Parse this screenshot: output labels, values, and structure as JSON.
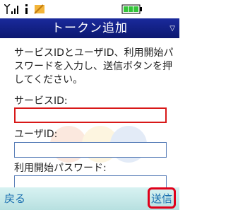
{
  "status": {
    "signal_icon": "signal-strength-icon",
    "mode_icon": "i-mode-icon",
    "mail_icon": "mail-icon",
    "battery_icon": "battery-icon",
    "battery_color": "#34c43a"
  },
  "header": {
    "title": "トークン追加",
    "menu_icon": "chevron-down-icon",
    "background": "#14218a"
  },
  "form": {
    "intro": "サービスIDとユーザID、利用開始パスワードを入力し、送信ボタンを押してください。",
    "service_id_label": "サービスID:",
    "service_id_value": "",
    "user_id_label": "ユーザID:",
    "user_id_value": "",
    "start_password_label": "利用開始パスワード:",
    "start_password_value": "",
    "focus_color": "#d81818"
  },
  "softkeys": {
    "left_label": "戻る",
    "right_label": "送信",
    "highlight_color": "#e0001a"
  }
}
